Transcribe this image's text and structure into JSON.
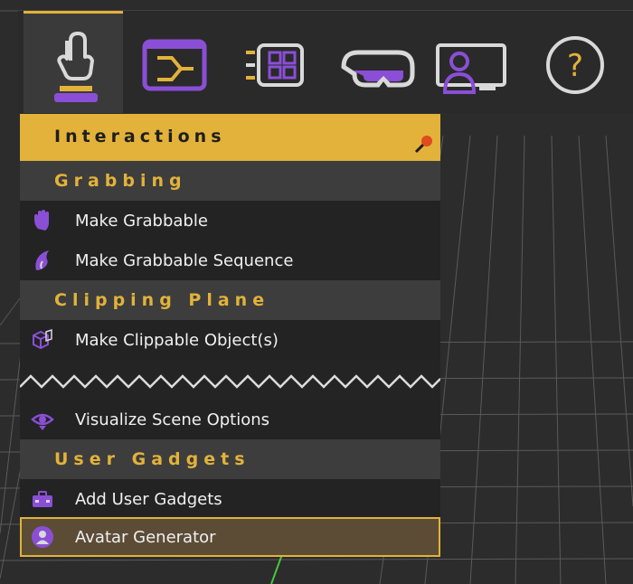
{
  "menu": {
    "header": "Interactions",
    "sections": {
      "grabbing": "Grabbing",
      "clipping": "Clipping Plane",
      "gadgets": "User Gadgets"
    },
    "items": {
      "make_grabbable": "Make Grabbable",
      "make_grabbable_sequence": "Make Grabbable Sequence",
      "make_clippable": "Make Clippable Object(s)",
      "visualize_scene": "Visualize Scene Options",
      "add_user_gadgets": "Add User Gadgets",
      "avatar_generator": "Avatar Generator"
    }
  },
  "colors": {
    "accent": "#e2b23a",
    "purple": "#8a4fd6",
    "panel": "#222222",
    "section_bg": "#3d3d3d",
    "active_bg": "#5c4c36"
  },
  "toolbar": {
    "icons": [
      "touch-hand-icon",
      "sequence-icon",
      "grid-panel-icon",
      "vr-headset-icon",
      "avatar-screen-icon",
      "help-icon"
    ]
  }
}
